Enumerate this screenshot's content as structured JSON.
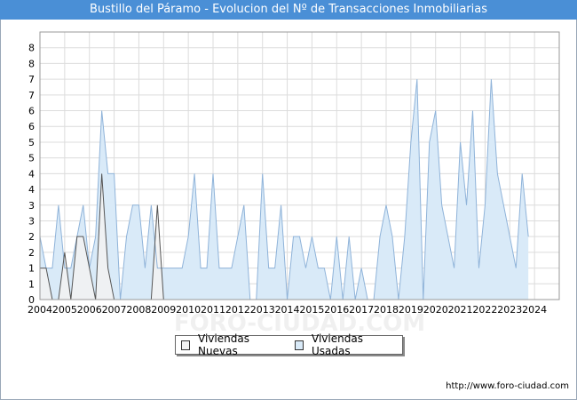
{
  "title": "Bustillo del Páramo - Evolucion del Nº de Transacciones Inmobiliarias",
  "footer_url": "http://www.foro-ciudad.com",
  "watermark": "FORO-CIUDAD.COM",
  "colors": {
    "title_bg": "#4a8fd6",
    "usadas_fill": "#d9eaf8",
    "usadas_line": "#8fb3d9",
    "nuevas_fill": "#f2f2f2",
    "nuevas_line": "#555555",
    "grid": "#dcdcdc"
  },
  "chart_data": {
    "type": "area",
    "x_start_year": 2004,
    "x_interval": "quarter",
    "x_ticks": [
      "2004",
      "2005",
      "2006",
      "2007",
      "2008",
      "2009",
      "2010",
      "2011",
      "2012",
      "2013",
      "2014",
      "2015",
      "2016",
      "2017",
      "2018",
      "2019",
      "2020",
      "2021",
      "2022",
      "2023",
      "2024"
    ],
    "ylim": [
      0,
      8.5
    ],
    "y_ticks": [
      "0",
      "1",
      "1",
      "2",
      "2",
      "3",
      "3",
      "4",
      "4",
      "5",
      "5",
      "6",
      "6",
      "7",
      "7",
      "8",
      "8"
    ],
    "grid": true,
    "legend_position": "bottom-center",
    "series": [
      {
        "name": "Viviendas Nuevas",
        "values": [
          1,
          1,
          0,
          0,
          1.5,
          0,
          2,
          2,
          1,
          0,
          4,
          1,
          0,
          0,
          0,
          0,
          0,
          0,
          0,
          3,
          0,
          0,
          0,
          0,
          0,
          0,
          0,
          0,
          0,
          0,
          0,
          0,
          0,
          0,
          0,
          0,
          0,
          0,
          0,
          0,
          0,
          0,
          0,
          0,
          0,
          0,
          0,
          0,
          0,
          0,
          0,
          0,
          0,
          0,
          0,
          0,
          0,
          0,
          0,
          0,
          0,
          0,
          0,
          0,
          0,
          0,
          0,
          0,
          0,
          0,
          0,
          0,
          0,
          0,
          0,
          0,
          0,
          0,
          0,
          0,
          0,
          0,
          0,
          0
        ]
      },
      {
        "name": "Viviendas Usadas",
        "values": [
          2,
          1,
          1,
          3,
          1,
          1,
          2,
          3,
          1,
          2,
          6,
          4,
          4,
          0,
          2,
          3,
          3,
          1,
          3,
          1,
          1,
          1,
          1,
          1,
          2,
          4,
          1,
          1,
          4,
          1,
          1,
          1,
          2,
          3,
          0,
          0,
          4,
          1,
          1,
          3,
          0,
          2,
          2,
          1,
          2,
          1,
          1,
          0,
          2,
          0,
          2,
          0,
          1,
          0,
          0,
          2,
          3,
          2,
          0,
          2,
          5,
          7,
          0,
          5,
          6,
          3,
          2,
          1,
          5,
          3,
          6,
          1,
          3,
          7,
          4,
          3,
          2,
          1,
          4,
          2
        ]
      }
    ]
  },
  "legend": {
    "nuevas_label": "Viviendas Nuevas",
    "usadas_label": "Viviendas Usadas"
  }
}
